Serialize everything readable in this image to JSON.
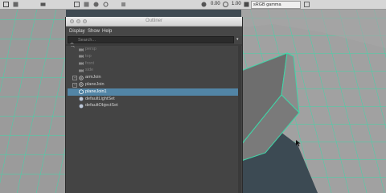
{
  "topbar": {
    "value_a": "0.00",
    "value_b": "1.00",
    "colorspace": "sRGB gamma"
  },
  "outliner": {
    "title": "Outliner",
    "menu": [
      "Display",
      "Show",
      "Help"
    ],
    "search_placeholder": "Search...",
    "items": [
      {
        "label": "persp",
        "icon": "camera-icon",
        "dim": true,
        "expander": false,
        "selected": false
      },
      {
        "label": "top",
        "icon": "camera-icon",
        "dim": true,
        "expander": false,
        "selected": false
      },
      {
        "label": "front",
        "icon": "camera-icon",
        "dim": true,
        "expander": false,
        "selected": false
      },
      {
        "label": "side",
        "icon": "camera-icon",
        "dim": true,
        "expander": false,
        "selected": false
      },
      {
        "label": "armJoin",
        "icon": "joint-icon",
        "dim": false,
        "expander": true,
        "selected": false
      },
      {
        "label": "planeJoin",
        "icon": "joint-icon",
        "dim": false,
        "expander": true,
        "selected": false
      },
      {
        "label": "planeJoin1",
        "icon": "mesh-icon",
        "dim": false,
        "expander": false,
        "selected": true
      },
      {
        "label": "defaultLightSet",
        "icon": "set-icon",
        "dim": false,
        "expander": false,
        "selected": false
      },
      {
        "label": "defaultObjectSet",
        "icon": "set-icon",
        "dim": false,
        "expander": false,
        "selected": false
      }
    ]
  },
  "colors": {
    "wire": "#39d7a6",
    "mesh_face": "#9a9a9a",
    "selection": "#5285a6",
    "background": "#3f4a52"
  }
}
